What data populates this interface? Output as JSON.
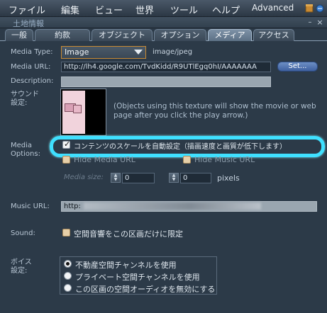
{
  "menubar": {
    "items": [
      "ファイル",
      "編集",
      "ビュー",
      "世界",
      "ツール",
      "ヘルプ",
      "Advanced"
    ],
    "icons": [
      "inventory-box-icon",
      "sound-icon"
    ]
  },
  "floater": {
    "title": "土地情報",
    "minimize_glyph": "–",
    "close_glyph": "×"
  },
  "tabs": [
    {
      "label": "一般",
      "active": false
    },
    {
      "label": "約款",
      "active": false
    },
    {
      "label": "オブジェクト",
      "active": false
    },
    {
      "label": "オプション",
      "active": false
    },
    {
      "label": "メディア",
      "active": true
    },
    {
      "label": "アクセス",
      "active": false
    }
  ],
  "media": {
    "type_label": "Media Type:",
    "type_value": "Image",
    "mime": "image/jpeg",
    "url_label": "Media URL:",
    "url_value": "http://lh4.google.com/TvdKidd/R9UTlEgq0hI/AAAAAAA",
    "set_button": "Set...",
    "description_label": "Description:",
    "description_value": "",
    "texture_label": "サウンド\n設定:",
    "texture_note": "(Objects using this texture will show the movie or web page after you click the play arrow.)",
    "options_label": "Media\nOptions:",
    "autoscale_label": "コンテンツのスケールを自動設定（描画速度と画質が低下します）",
    "autoscale_checked": true,
    "hide_media_url_label": "Hide Media URL",
    "hide_music_url_label": "Hide Music URL",
    "media_size_label": "Media size:",
    "width_value": "0",
    "height_value": "0",
    "size_unit": "pixels"
  },
  "music": {
    "url_label": "Music URL:",
    "url_value": "http:"
  },
  "sound": {
    "label": "Sound:",
    "restrict_label": "空間音響をこの区画だけに限定"
  },
  "voice": {
    "label": "ボイス\n設定:",
    "options": [
      {
        "label": "不動産空間チャンネルを使用",
        "selected": true
      },
      {
        "label": "プライベート空間チャンネルを使用",
        "selected": false
      },
      {
        "label": "この区画の空間オーディオを無効にする",
        "selected": false
      }
    ]
  },
  "colors": {
    "background": "#2c3a48",
    "accent_highlight": "#3fe0ff",
    "set_button": "#4f72b0",
    "combo_border": "#c98a32"
  }
}
